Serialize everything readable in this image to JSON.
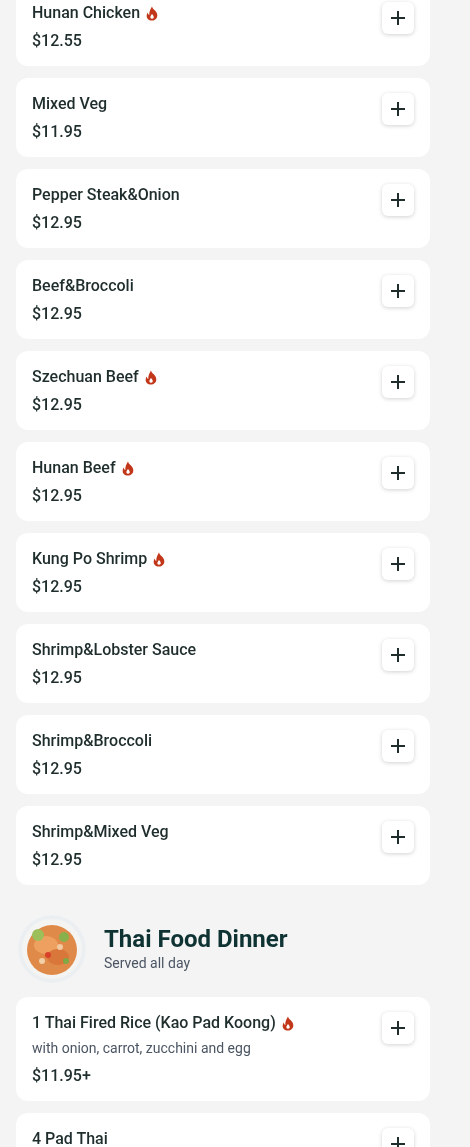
{
  "items": [
    {
      "name": "Hunan Chicken",
      "spicy": true,
      "price": "$12.55"
    },
    {
      "name": "Mixed Veg",
      "spicy": false,
      "price": "$11.95"
    },
    {
      "name": "Pepper Steak&Onion",
      "spicy": false,
      "price": "$12.95"
    },
    {
      "name": "Beef&Broccoli",
      "spicy": false,
      "price": "$12.95"
    },
    {
      "name": "Szechuan Beef",
      "spicy": true,
      "price": "$12.95"
    },
    {
      "name": "Hunan Beef",
      "spicy": true,
      "price": "$12.95"
    },
    {
      "name": "Kung Po Shrimp",
      "spicy": true,
      "price": "$12.95"
    },
    {
      "name": "Shrimp&Lobster Sauce",
      "spicy": false,
      "price": "$12.95"
    },
    {
      "name": "Shrimp&Broccoli",
      "spicy": false,
      "price": "$12.95"
    },
    {
      "name": "Shrimp&Mixed Veg",
      "spicy": false,
      "price": "$12.95"
    }
  ],
  "section": {
    "title": "Thai Food Dinner",
    "subtitle": "Served all day",
    "items": [
      {
        "name": "1 Thai Fired Rice (Kao Pad Koong)",
        "spicy": true,
        "description": "with onion, carrot, zucchini and egg",
        "price": "$11.95+"
      },
      {
        "name": "4 Pad Thai",
        "spicy": false
      }
    ]
  }
}
